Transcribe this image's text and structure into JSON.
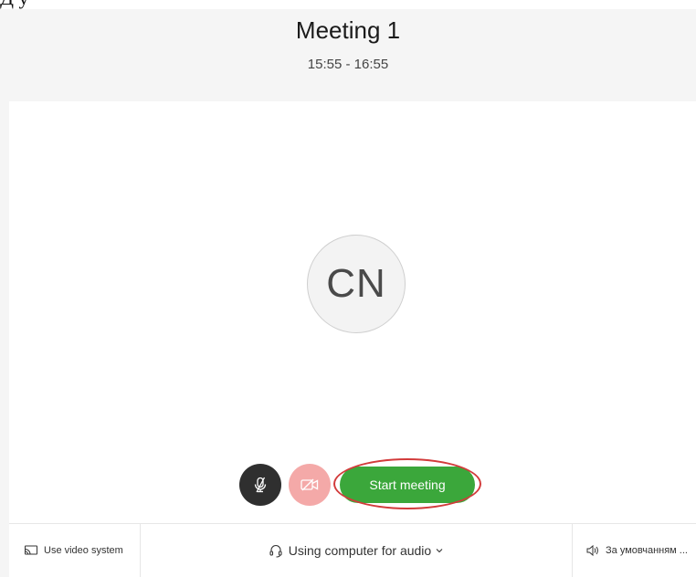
{
  "top_partial_text": "Д                                                  у",
  "meeting": {
    "title": "Meeting 1",
    "time": "15:55 - 16:55"
  },
  "avatar": {
    "initials": "CN"
  },
  "controls": {
    "start_label": "Start meeting",
    "mute_icon": "microphone-muted-icon",
    "video_icon": "video-off-icon"
  },
  "bottom_bar": {
    "video_system_label": "Use video system",
    "audio_label": "Using computer for audio",
    "speaker_label": "За умовчанням ..."
  },
  "colors": {
    "start_button": "#3ba73b",
    "mute_button": "#2f2f2f",
    "video_button": "#f4a9a8",
    "highlight": "#d23b3b"
  }
}
